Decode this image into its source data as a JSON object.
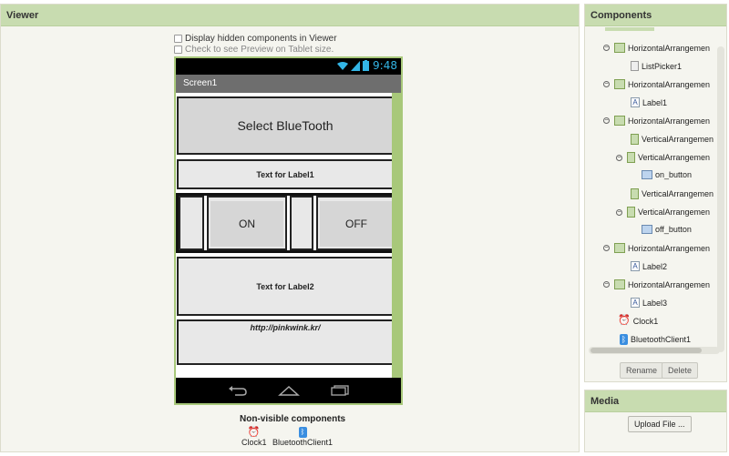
{
  "viewer": {
    "title": "Viewer",
    "option_hidden": "Display hidden components in Viewer",
    "option_tablet": "Check to see Preview on Tablet size.",
    "status_time": "9:48",
    "screen_title": "Screen1",
    "select_button": "Select BlueTooth",
    "label1": "Text for Label1",
    "on_button": "ON",
    "off_button": "OFF",
    "label2": "Text for Label2",
    "label3": "http://pinkwink.kr/",
    "nonvisible_title": "Non-visible components",
    "nonvisible": [
      {
        "label": "Clock1",
        "icon": "clock-icon"
      },
      {
        "label": "BluetoothClient1",
        "icon": "bluetooth-icon"
      }
    ]
  },
  "components": {
    "title": "Components",
    "tree": [
      {
        "label": "HorizontalArrangemen",
        "icon": "horizontal-arrangement-icon",
        "toggle": "⊖"
      },
      {
        "label": "ListPicker1",
        "icon": "listpicker-icon",
        "toggle": ""
      },
      {
        "label": "HorizontalArrangemen",
        "icon": "horizontal-arrangement-icon",
        "toggle": "⊖"
      },
      {
        "label": "Label1",
        "icon": "label-icon",
        "toggle": ""
      },
      {
        "label": "HorizontalArrangemen",
        "icon": "horizontal-arrangement-icon",
        "toggle": "⊖"
      },
      {
        "label": "VerticalArrangemen",
        "icon": "vertical-arrangement-icon",
        "toggle": ""
      },
      {
        "label": "VerticalArrangemen",
        "icon": "vertical-arrangement-icon",
        "toggle": "⊖"
      },
      {
        "label": "on_button",
        "icon": "button-icon",
        "toggle": ""
      },
      {
        "label": "VerticalArrangemen",
        "icon": "vertical-arrangement-icon",
        "toggle": ""
      },
      {
        "label": "VerticalArrangemen",
        "icon": "vertical-arrangement-icon",
        "toggle": "⊖"
      },
      {
        "label": "off_button",
        "icon": "button-icon",
        "toggle": ""
      },
      {
        "label": "HorizontalArrangemen",
        "icon": "horizontal-arrangement-icon",
        "toggle": "⊖"
      },
      {
        "label": "Label2",
        "icon": "label-icon",
        "toggle": ""
      },
      {
        "label": "HorizontalArrangemen",
        "icon": "horizontal-arrangement-icon",
        "toggle": "⊖"
      },
      {
        "label": "Label3",
        "icon": "label-icon",
        "toggle": ""
      },
      {
        "label": "Clock1",
        "icon": "clock-icon",
        "toggle": ""
      },
      {
        "label": "BluetoothClient1",
        "icon": "bluetooth-icon",
        "toggle": ""
      }
    ],
    "rename_label": "Rename",
    "delete_label": "Delete"
  },
  "media": {
    "title": "Media",
    "upload_label": "Upload File ..."
  },
  "colors": {
    "header_green": "#c8dcb0",
    "phone_border": "#a8c87a",
    "status_blue": "#33b5e5"
  }
}
